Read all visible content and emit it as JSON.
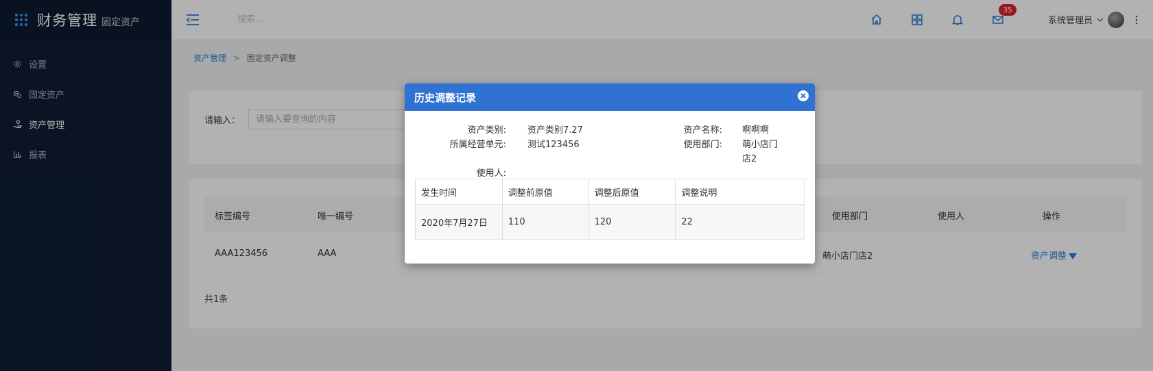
{
  "app": {
    "title": "财务管理",
    "subtitle": "固定资产"
  },
  "sidebar": {
    "items": [
      {
        "label": "设置",
        "icon": "gear-icon"
      },
      {
        "label": "固定资产",
        "icon": "coins-icon"
      },
      {
        "label": "资产管理",
        "icon": "hand-coin-icon"
      },
      {
        "label": "报表",
        "icon": "bar-chart-icon"
      }
    ],
    "active_index": 2
  },
  "header": {
    "search_placeholder": "搜索...",
    "mail_badge": "35",
    "user_name": "系统管理员"
  },
  "breadcrumb": {
    "parent": "资产管理",
    "separator": ">",
    "current": "固定资产调整"
  },
  "search": {
    "label": "请输入：",
    "placeholder": "请输入要查询的内容"
  },
  "table": {
    "headers": {
      "tag_no": "标签编号",
      "unique_no": "唯一编号",
      "department": "使用部门",
      "user": "使用人",
      "action": "操作"
    },
    "row": {
      "tag_no": "AAA123456",
      "unique_no": "AAA",
      "department": "萌小店门店2",
      "action": "资产调整"
    },
    "total": "共1条"
  },
  "modal": {
    "title": "历史调整记录",
    "fields": {
      "asset_category_label": "资产类别:",
      "asset_category_value": "资产类别7.27",
      "business_unit_label": "所属经营单元:",
      "business_unit_value": "测试123456",
      "asset_name_label": "资产名称:",
      "asset_name_value": "啊啊啊",
      "department_label": "使用部门:",
      "department_value_line1": "萌小店门",
      "department_value_line2": "店2",
      "user_label": "使用人:"
    },
    "history": {
      "headers": [
        "发生时间",
        "调整前原值",
        "调整后原值",
        "调整说明"
      ],
      "rows": [
        [
          "2020年7月27日",
          "110",
          "120",
          "22"
        ]
      ]
    }
  },
  "colors": {
    "sidebar_bg": "#0f1e34",
    "accent": "#2f72d1",
    "link": "#2b7ad6",
    "badge": "#d9252b"
  }
}
